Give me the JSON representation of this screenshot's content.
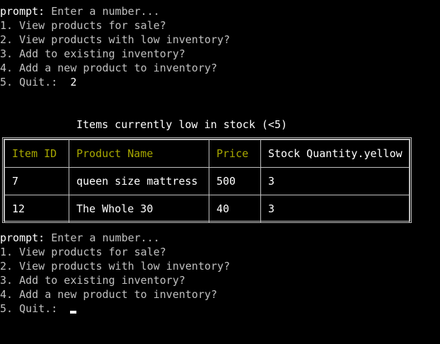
{
  "session1": {
    "prompt_label": "prompt:",
    "prompt_message": " Enter a number...",
    "menu": [
      "1. View products for sale?",
      "2. View products with low inventory?",
      "3. Add to existing inventory?",
      "4. Add a new product to inventory?",
      "5. Quit.:"
    ],
    "answer": "2"
  },
  "table": {
    "title": "Items currently low in stock (<5)",
    "headers": [
      "Item ID",
      "Product Name",
      "Price",
      "Stock Quantity.yellow"
    ],
    "rows": [
      [
        "7",
        "queen size mattress",
        "500",
        "3"
      ],
      [
        "12",
        "The Whole 30",
        "40",
        "3"
      ]
    ]
  },
  "session2": {
    "prompt_label": "prompt:",
    "prompt_message": " Enter a number...",
    "menu": [
      "1. View products for sale?",
      "2. View products with low inventory?",
      "3. Add to existing inventory?",
      "4. Add a new product to inventory?",
      "5. Quit.:"
    ],
    "answer": ""
  },
  "colors": {
    "background": "#000000",
    "text": "#c0c0c0",
    "header_yellow": "#a8a800",
    "bright": "#ffffff"
  }
}
